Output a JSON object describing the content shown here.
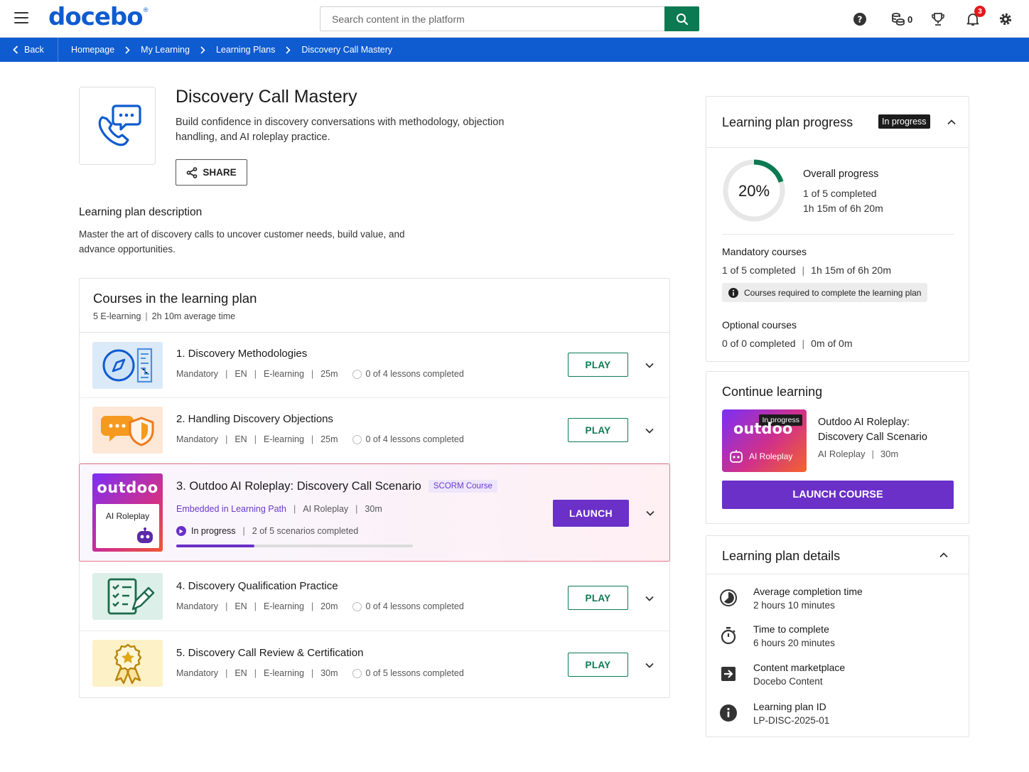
{
  "header": {
    "logo": "docebo",
    "logo_mark": "®",
    "search_placeholder": "Search content in the platform",
    "coins_count": "0",
    "notifications_count": "3"
  },
  "breadcrumb": {
    "back_label": "Back",
    "items": [
      "Homepage",
      "My Learning",
      "Learning Plans",
      "Discovery Call Mastery"
    ]
  },
  "plan": {
    "title": "Discovery Call Mastery",
    "subtitle": "Build confidence in discovery conversations with methodology, objection handling, and AI roleplay practice.",
    "share_label": "SHARE",
    "description_heading": "Learning plan description",
    "description": "Master the art of discovery calls to uncover customer needs, build value, and advance opportunities."
  },
  "courses": {
    "title": "Courses in the learning plan",
    "meta_count": "5 E-learning",
    "meta_time": "2h 10m average time",
    "items": [
      {
        "title": "1. Discovery Methodologies",
        "type": "Mandatory",
        "lang": "EN",
        "format": "E-learning",
        "duration": "25m",
        "lessons": "0 of 4 lessons completed",
        "action": "PLAY"
      },
      {
        "title": "2. Handling Discovery Objections",
        "type": "Mandatory",
        "lang": "EN",
        "format": "E-learning",
        "duration": "25m",
        "lessons": "0 of 4 lessons completed",
        "action": "PLAY"
      },
      {
        "title": "3. Outdoo AI Roleplay: Discovery Call Scenario",
        "badge": "SCORM Course",
        "embedded": "Embedded in Learning Path",
        "format": "AI Roleplay",
        "duration": "30m",
        "status": "In progress",
        "scenarios": "2 of 5 scenarios completed",
        "progress": 0.33,
        "action": "LAUNCH",
        "thumb_word": "outdoo",
        "thumb_label": "AI Roleplay"
      },
      {
        "title": "4. Discovery Qualification Practice",
        "type": "Mandatory",
        "lang": "EN",
        "format": "E-learning",
        "duration": "20m",
        "lessons": "0 of 4 lessons completed",
        "action": "PLAY"
      },
      {
        "title": "5. Discovery Call Review & Certification",
        "type": "Mandatory",
        "lang": "EN",
        "format": "E-learning",
        "duration": "30m",
        "lessons": "0 of 5 lessons completed",
        "action": "PLAY"
      }
    ]
  },
  "progress_card": {
    "title": "Learning plan progress",
    "status": "In progress",
    "percent_label": "20%",
    "percent": 0.2,
    "overall_label": "Overall progress",
    "overall_completed": "1 of 5 completed",
    "overall_time": "1h 15m of 6h 20m",
    "mandatory_label": "Mandatory courses",
    "mandatory_completed": "1 of 5 completed",
    "mandatory_time": "1h 15m of 6h 20m",
    "info_chip": "Courses required to complete the learning plan",
    "optional_label": "Optional courses",
    "optional_completed": "0 of 0 completed",
    "optional_time": "0m of 0m"
  },
  "continue_card": {
    "title": "Continue learning",
    "badge": "In progress",
    "thumb_word": "outdoo",
    "thumb_label": "AI Roleplay",
    "course_title_line1": "Outdoo AI Roleplay:",
    "course_title_line2": "Discovery Call Scenario",
    "format": "AI Roleplay",
    "duration": "30m",
    "button": "LAUNCH COURSE"
  },
  "details_card": {
    "title": "Learning plan details",
    "items": [
      {
        "label": "Average completion time",
        "value": "2 hours 10 minutes",
        "icon": "clock-icon"
      },
      {
        "label": "Time to complete",
        "value": "6 hours 20 minutes",
        "icon": "stopwatch-icon"
      },
      {
        "label": "Content marketplace",
        "value": "Docebo Content",
        "icon": "marketplace-icon"
      },
      {
        "label": "Learning plan ID",
        "value": "LP-DISC-2025-01",
        "icon": "info-icon"
      }
    ]
  },
  "colors": {
    "brand_blue": "#0f5bd0",
    "action_green": "#0b7a52",
    "accent_purple": "#6a30c8",
    "progress_green": "#0b7a52"
  }
}
